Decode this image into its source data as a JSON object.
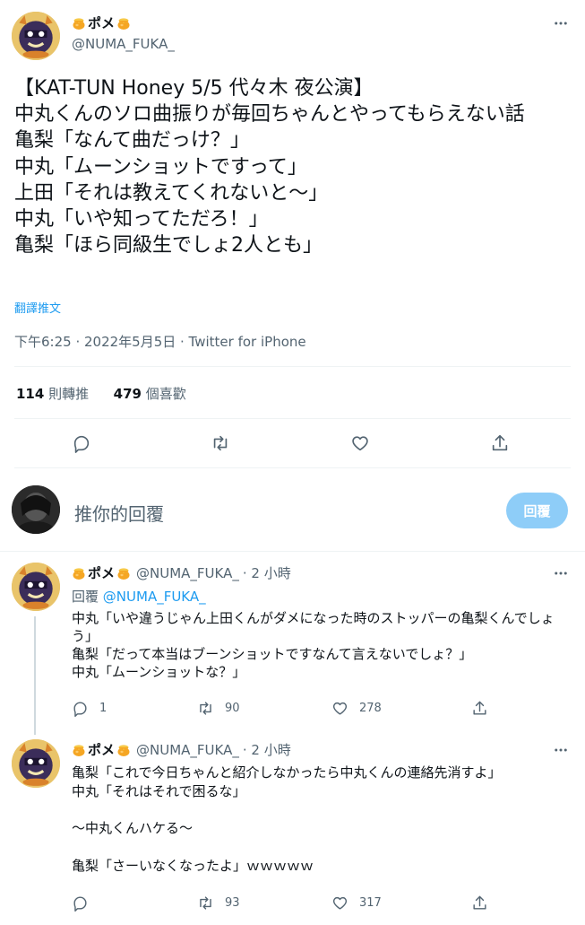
{
  "colors": {
    "text": "#0f1419",
    "muted": "#536471",
    "link": "#1d9bf0",
    "reply_button_bg": "#8ecdf8",
    "divider": "#eff3f4"
  },
  "main_tweet": {
    "display_name": "ポメ",
    "handle": "@NUMA_FUKA_",
    "text": "【KAT-TUN Honey 5/5 代々木 夜公演】\n中丸くんのソロ曲振りが毎回ちゃんとやってもらえない話\n亀梨「なんて曲だっけ？」\n中丸「ムーンショットですって」\n上田「それは教えてくれないと〜」\n中丸「いや知ってただろ！」\n亀梨「ほら同級生でしょ2人とも」",
    "translate_label": "翻譯推文",
    "meta": "下午6:25 · 2022年5月5日 · Twitter for iPhone",
    "retweets": "114",
    "retweets_label": "則轉推",
    "likes": "479",
    "likes_label": "個喜歡",
    "icons": [
      "reply-icon",
      "retweet-icon",
      "like-icon",
      "share-icon",
      "more-icon"
    ]
  },
  "reply_composer": {
    "placeholder": "推你的回覆",
    "button_label": "回覆"
  },
  "replies": [
    {
      "display_name": "ポメ",
      "handle": "@NUMA_FUKA_",
      "time": "· 2 小時",
      "replying_to_label": "回覆",
      "replying_to_handle": "@NUMA_FUKA_",
      "text": "中丸「いや違うじゃん上田くんがダメになった時のストッパーの亀梨くんでしょう」\n亀梨「だって本当はブーンショットですなんて言えないでしょ？」\n中丸「ムーンショットな？」",
      "reply_count": "1",
      "retweet_count": "90",
      "like_count": "278"
    },
    {
      "display_name": "ポメ",
      "handle": "@NUMA_FUKA_",
      "time": "· 2 小時",
      "text": "亀梨「これで今日ちゃんと紹介しなかったら中丸くんの連絡先消すよ」\n中丸「それはそれで困るな」\n\n〜中丸くんハケる〜\n\n亀梨「さーいなくなったよ」ｗｗｗｗｗ",
      "reply_count": "",
      "retweet_count": "93",
      "like_count": "317"
    }
  ]
}
